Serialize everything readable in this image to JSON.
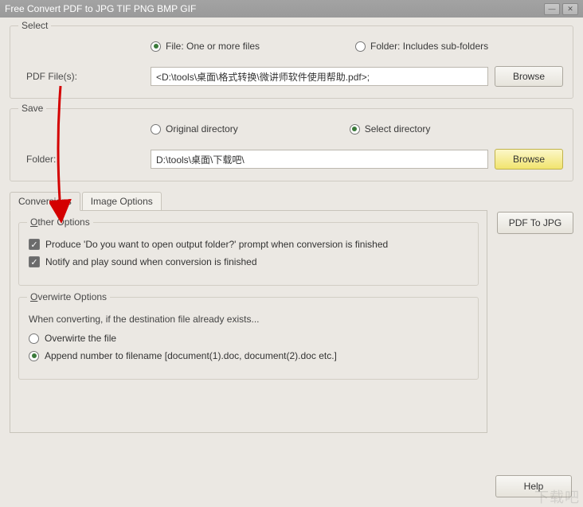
{
  "title": "Free Convert PDF to JPG TIF PNG BMP GIF",
  "select": {
    "legend": "Select",
    "file_option": "File:  One or more files",
    "folder_option": "Folder: Includes sub-folders",
    "label": "PDF File(s):",
    "value": "<D:\\tools\\桌面\\格式转换\\微讲师软件使用帮助.pdf>;",
    "browse": "Browse"
  },
  "save": {
    "legend": "Save",
    "original_option": "Original directory",
    "select_option": "Select directory",
    "label": "Folder:",
    "value": "D:\\tools\\桌面\\下载吧\\",
    "browse": "Browse"
  },
  "tabs": {
    "conversions": "Conversions",
    "image_options": "Image Options"
  },
  "other_options": {
    "legend_prefix": "O",
    "legend_rest": "ther Options",
    "opt1": "Produce 'Do you want to open output folder?' prompt when conversion is finished",
    "opt2": "Notify and play sound when conversion is finished"
  },
  "overwrite": {
    "legend_prefix": "O",
    "legend_rest": "verwirte Options",
    "desc": "When converting, if the destination file already exists...",
    "opt_overwrite": "Overwirte the file",
    "opt_append": "Append number to filename  [document(1).doc, document(2).doc etc.]"
  },
  "buttons": {
    "pdf_to_jpg": "PDF To JPG",
    "help": "Help"
  },
  "watermark": "下载吧"
}
